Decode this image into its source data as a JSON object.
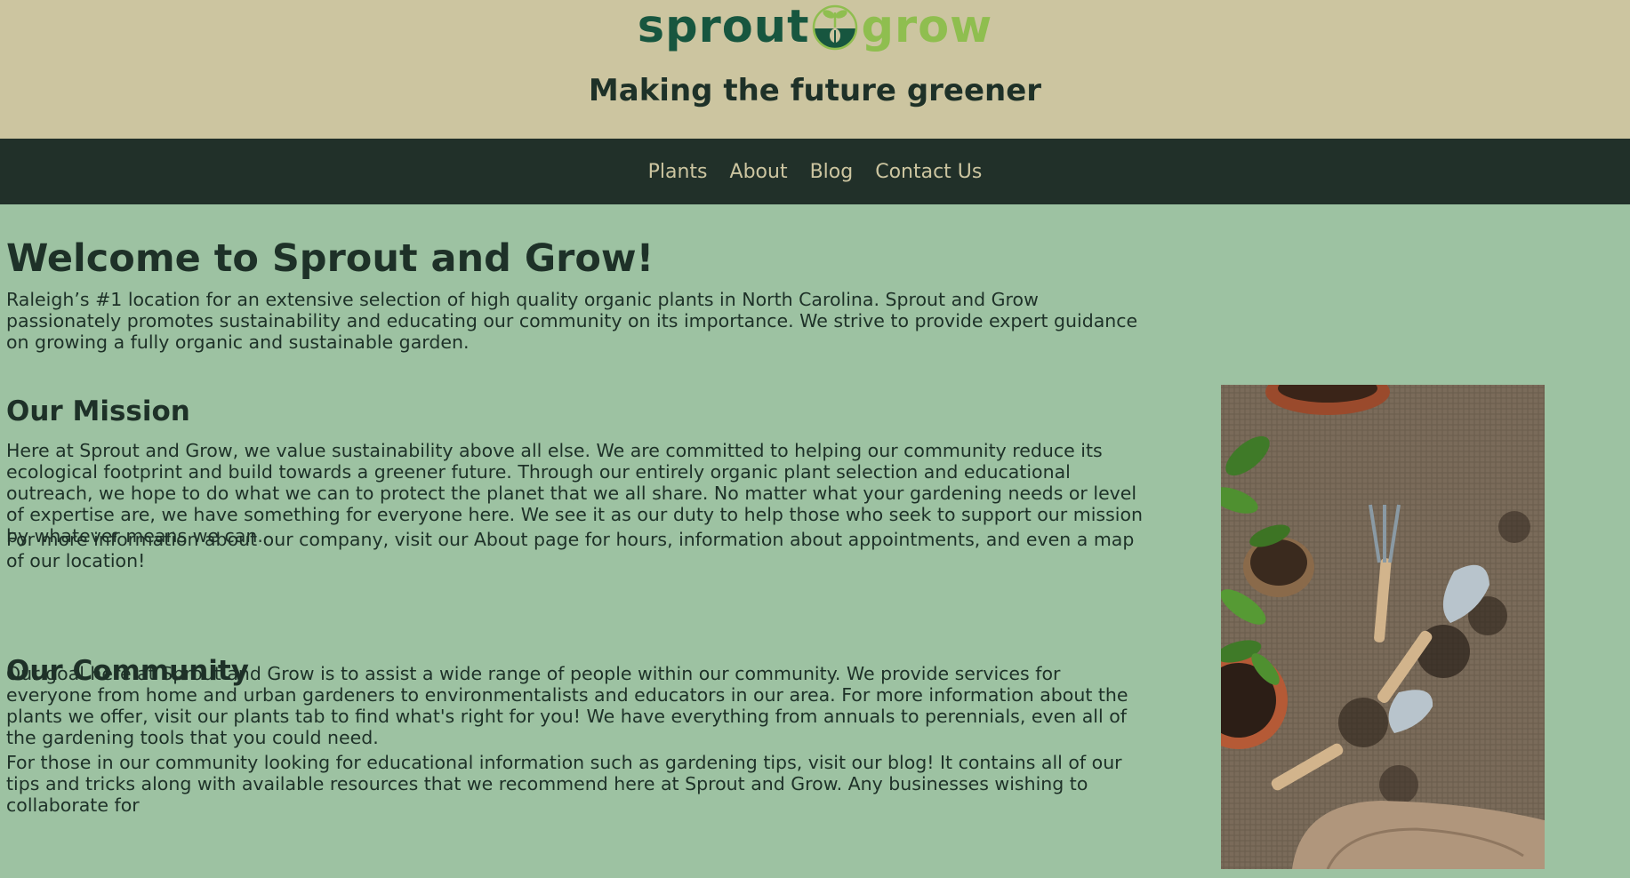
{
  "header": {
    "logo_word1": "sprout",
    "logo_word2": "grow",
    "tagline": "Making the future greener"
  },
  "nav": {
    "items": [
      "Plants",
      "About",
      "Blog",
      "Contact Us"
    ]
  },
  "main": {
    "title": "Welcome to Sprout and Grow!",
    "intro": "Raleigh’s #1 location for an extensive selection of high quality organic plants in North Carolina. Sprout and Grow passionately promotes sustainability and educating our community on its importance. We strive to provide expert guidance on growing a fully organic and sustainable garden.",
    "mission_heading": "Our Mission",
    "mission_p1": "Here at Sprout and Grow, we value sustainability above all else. We are committed to helping our community reduce its ecological footprint and build towards a greener future. Through our entirely organic plant selection and educational outreach, we hope to do what we can to protect the planet that we all share. No matter what your gardening needs or level of expertise are, we have something for everyone here. We see it as our duty to help those who seek to support our mission by whatever means we can.",
    "mission_p2": "For more information about our company, visit our About page for hours, information about appointments, and even a map of our location!",
    "community_heading": "Our Community",
    "community_p1": "Our goal here at Sprout and Grow is to assist a wide range of people within our community. We provide services for everyone from home and urban gardeners to environmentalists and educators in our area. For more information about the plants we offer, visit our plants tab to find what's right for you! We have everything from annuals to perennials, even all of the gardening tools that you could need.",
    "community_p2": "For those in our community looking for educational information such as gardening tips, visit our blog! It contains all of our tips and tricks along with available resources that we recommend here at Sprout and Grow. Any businesses wishing to collaborate for"
  },
  "colors": {
    "header_bg": "#ccc5a0",
    "nav_bg": "#213029",
    "page_bg": "#9dc2a2",
    "text": "#1e3128",
    "logo_dark": "#17563f",
    "logo_light": "#8fbe4f"
  }
}
